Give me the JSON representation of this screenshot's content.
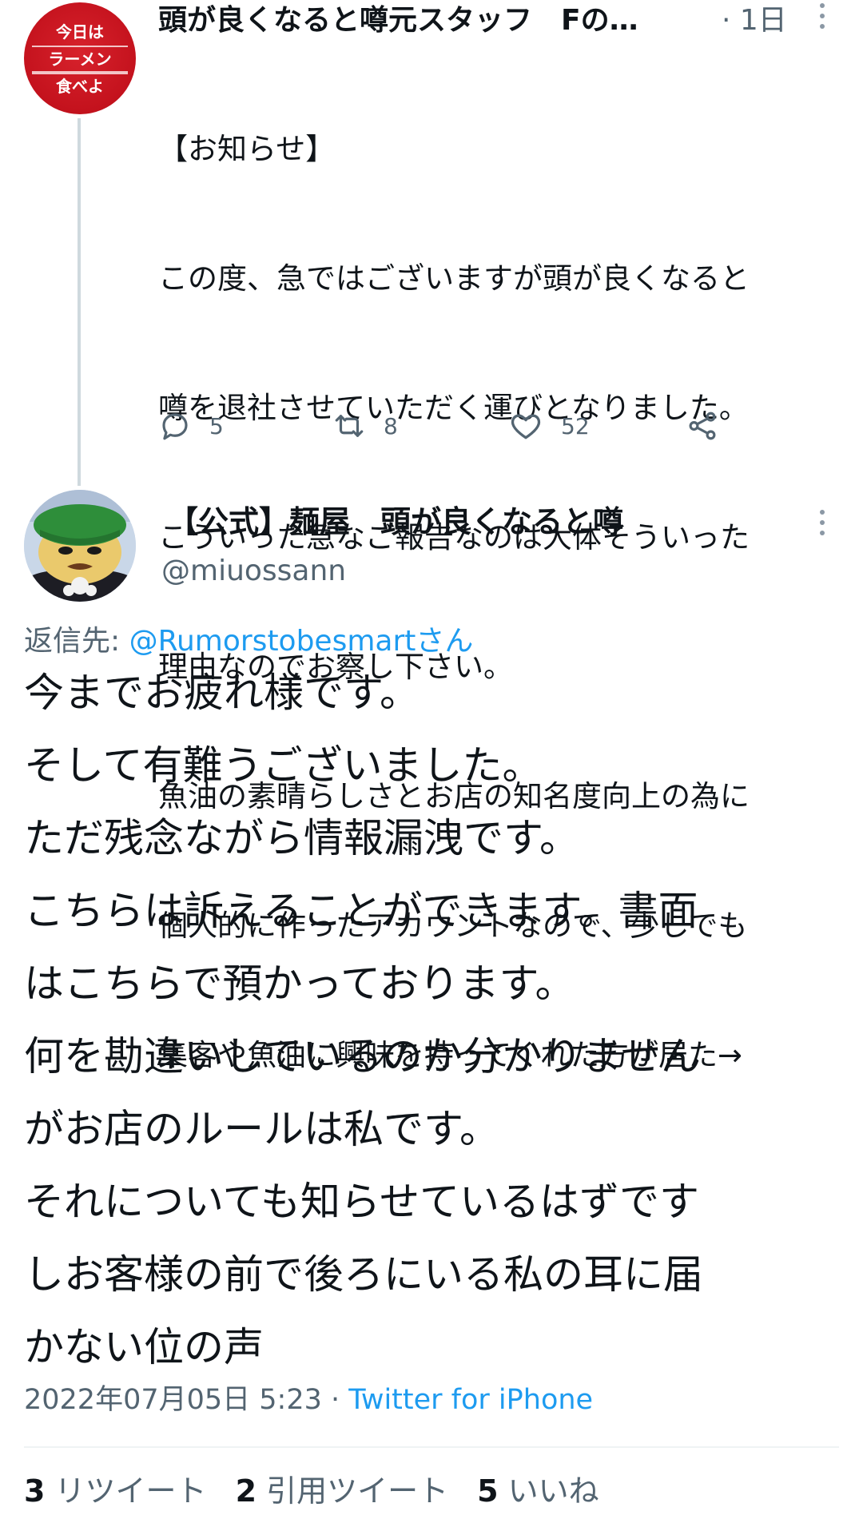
{
  "parent_tweet": {
    "avatar_sign": [
      "今日は",
      "ラーメン",
      "食べよ"
    ],
    "display_name": "頭が良くなると噂元スタッフ　Fの…",
    "timestamp": "· 1日",
    "body_lines": [
      "【お知らせ】",
      "この度、急ではございますが頭が良くなると",
      "噂を退社させていただく運びとなりました。",
      "こういった急なご報告なのは大体そういった",
      "理由なのでお察し下さい。",
      "魚油の素晴らしさとお店の知名度向上の為に",
      "個人的に作ったアカウントなので、少しでも",
      "集客や魚油に興味を持ってくれた方が居た→"
    ],
    "reply_count": "5",
    "retweet_count": "8",
    "like_count": "52"
  },
  "main_tweet": {
    "display_name": "【公式】麺屋　頭が良くなると噂",
    "handle": "@miuossann",
    "replying_label": "返信先: ",
    "replying_to": "@Rumorstobesmartさん",
    "body_lines": [
      "今までお疲れ様です。",
      "そして有難うございました。",
      "ただ残念ながら情報漏洩です。",
      "こちらは訴えることができます。書面",
      "はこちらで預かっております。",
      "何を勘違いしているのか分かりません",
      "がお店のルールは私です。",
      "それについても知らせているはずです",
      "しお客様の前で後ろにいる私の耳に届",
      "かない位の声"
    ],
    "datetime": "2022年07月05日 5:23 · ",
    "source": "Twitter for iPhone",
    "stats": {
      "retweets_num": "3",
      "retweets_label": "リツイート",
      "quotes_num": "2",
      "quotes_label": "引用ツイート",
      "likes_num": "5",
      "likes_label": "いいね"
    }
  },
  "colors": {
    "text": "#0f1419",
    "secondary": "#536471",
    "link": "#1d9bf0",
    "divider": "#eff3f4"
  }
}
